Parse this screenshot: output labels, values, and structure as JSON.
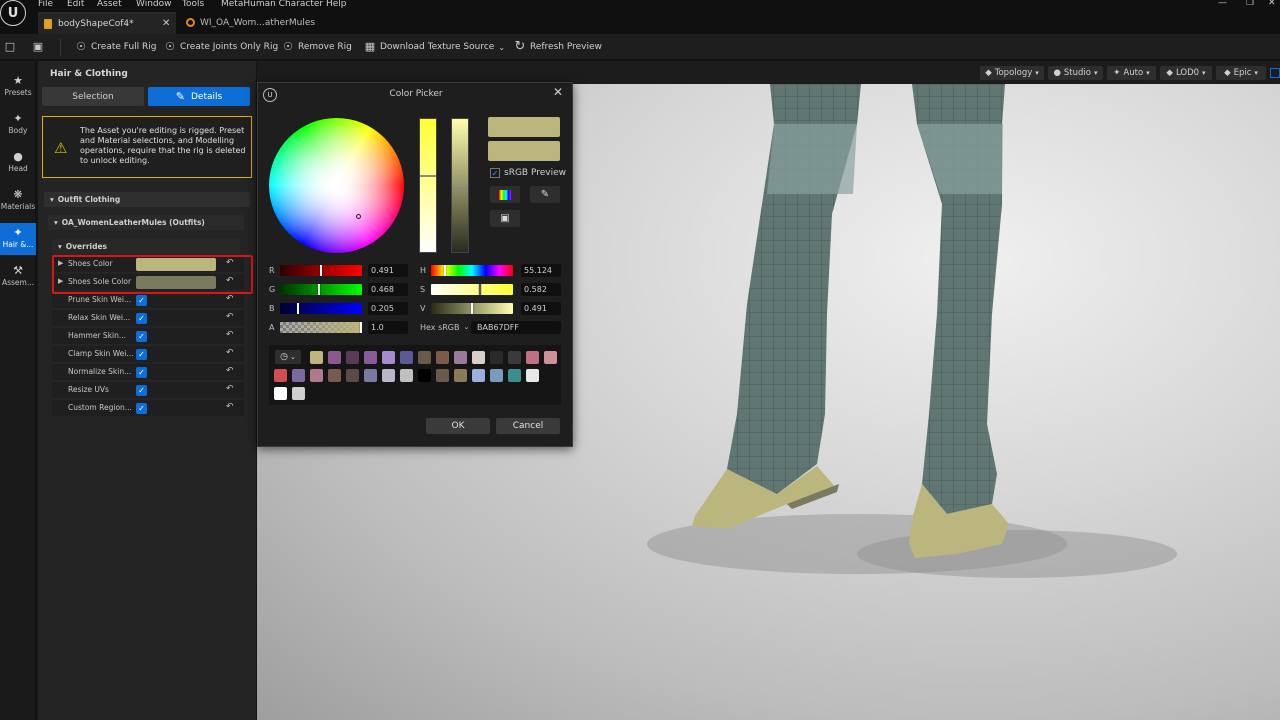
{
  "menu": {
    "items": [
      "File",
      "Edit",
      "Asset",
      "Window",
      "Tools",
      "MetaHuman Character",
      "Help"
    ]
  },
  "logo": {
    "glyph": "U"
  },
  "tabs": [
    {
      "label": "bodyShapeCof4*"
    },
    {
      "label": "WI_OA_Wom...atherMules"
    }
  ],
  "toolbar": {
    "create_full_rig": "Create Full Rig",
    "create_joints_only_rig": "Create Joints Only Rig",
    "remove_rig": "Remove Rig",
    "download_texture_source": "Download Texture Source",
    "refresh_preview": "Refresh Preview"
  },
  "rail": {
    "items": [
      "Presets",
      "Body",
      "Head",
      "Materials",
      "Hair &...",
      "Assem..."
    ]
  },
  "panel": {
    "title": "Hair & Clothing",
    "selection_tab": "Selection",
    "details_tab": "Details",
    "warning": "The Asset you're editing is rigged. Preset and Material selections, and Modelling operations, require that the rig is deleted to unlock editing.",
    "outfit_section": "Outfit Clothing",
    "outfit_name": "OA_WomenLeatherMules (Outfits)",
    "overrides_section": "Overrides",
    "color_rows": [
      {
        "label": "Shoes Color",
        "color": "#bab67d"
      },
      {
        "label": "Shoes Sole Color",
        "color": "#7a7a5e"
      }
    ],
    "check_rows": [
      {
        "label": "Prune Skin Wei..."
      },
      {
        "label": "Relax Skin Wei..."
      },
      {
        "label": "Hammer Skin..."
      },
      {
        "label": "Clamp Skin Wei..."
      },
      {
        "label": "Normalize Skin..."
      },
      {
        "label": "Resize UVs"
      },
      {
        "label": "Custom Region..."
      }
    ]
  },
  "viewport": {
    "buttons": [
      "Topology",
      "Studio",
      "Auto",
      "LOD0",
      "Epic"
    ]
  },
  "color_picker": {
    "title": "Color Picker",
    "srgb_preview": "sRGB Preview",
    "current_color": "#bab67d",
    "old_color": "#bab67d",
    "r_label": "R",
    "r_value": "0.491",
    "r_level": 0.491,
    "g_label": "G",
    "g_value": "0.468",
    "g_level": 0.468,
    "b_label": "B",
    "b_value": "0.205",
    "b_level": 0.205,
    "a_label": "A",
    "a_value": "1.0",
    "a_level": 1.0,
    "h_label": "H",
    "h_value": "55.124",
    "h_level": 0.153,
    "s_label": "S",
    "s_value": "0.582",
    "s_level": 0.582,
    "v_label": "V",
    "v_value": "0.491",
    "v_level": 0.491,
    "hex_label": "Hex sRGB",
    "hex_value": "BAB67DFF",
    "palette": [
      "#bab67d",
      "#8a5a8a",
      "#5a3a5a",
      "#8a5a9a",
      "#a58ad0",
      "#5a5a9a",
      "#6a5a4a",
      "#7a5a4a",
      "#9a7a9a",
      "#d8d0c8",
      "#2a2a2a",
      "#3a3a3a",
      "#c07080",
      "#d09098",
      "#d05050",
      "#7a6aa0",
      "#b07a8a",
      "#7a5a50",
      "#5a4a4a",
      "#7a7aa0",
      "#b8b8c8",
      "#c0c0c0",
      "#000000",
      "#6a5a4a",
      "#8a7a5a",
      "#9ab0e0",
      "#7a9ac0",
      "#3a9090",
      "#e8e8e8",
      "#ffffff",
      "#d0d0d0"
    ],
    "ok": "OK",
    "cancel": "Cancel"
  }
}
